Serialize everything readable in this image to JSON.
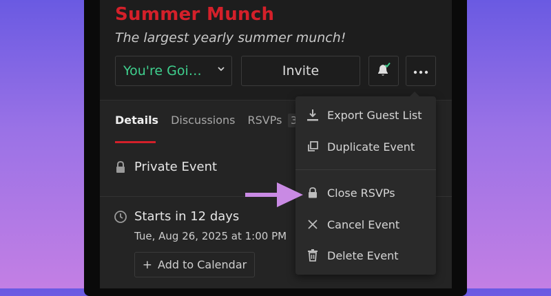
{
  "event": {
    "title": "Summer Munch",
    "subtitle": "The largest yearly summer munch!",
    "rsvp_status": "You're Goi…",
    "invite_label": "Invite"
  },
  "tabs": [
    {
      "label": "Details",
      "active": true
    },
    {
      "label": "Discussions",
      "active": false
    },
    {
      "label": "RSVPs",
      "active": false,
      "count": "3"
    }
  ],
  "details": {
    "privacy": "Private Event",
    "starts": "Starts in 12 days",
    "date": "Tue, Aug 26, 2025 at 1:00 PM",
    "add_calendar_label": "Add to Calendar"
  },
  "menu": {
    "items": [
      {
        "label": "Export Guest List",
        "icon": "download-icon"
      },
      {
        "label": "Duplicate Event",
        "icon": "duplicate-icon"
      },
      {
        "label": "Close RSVPs",
        "icon": "lock-icon"
      },
      {
        "label": "Cancel Event",
        "icon": "x-icon"
      },
      {
        "label": "Delete Event",
        "icon": "trash-icon"
      }
    ]
  },
  "colors": {
    "brand_red": "#d4202a",
    "going_green": "#3fd08e",
    "arrow_purple": "#c98ae4",
    "background": "#1d1d1d"
  }
}
